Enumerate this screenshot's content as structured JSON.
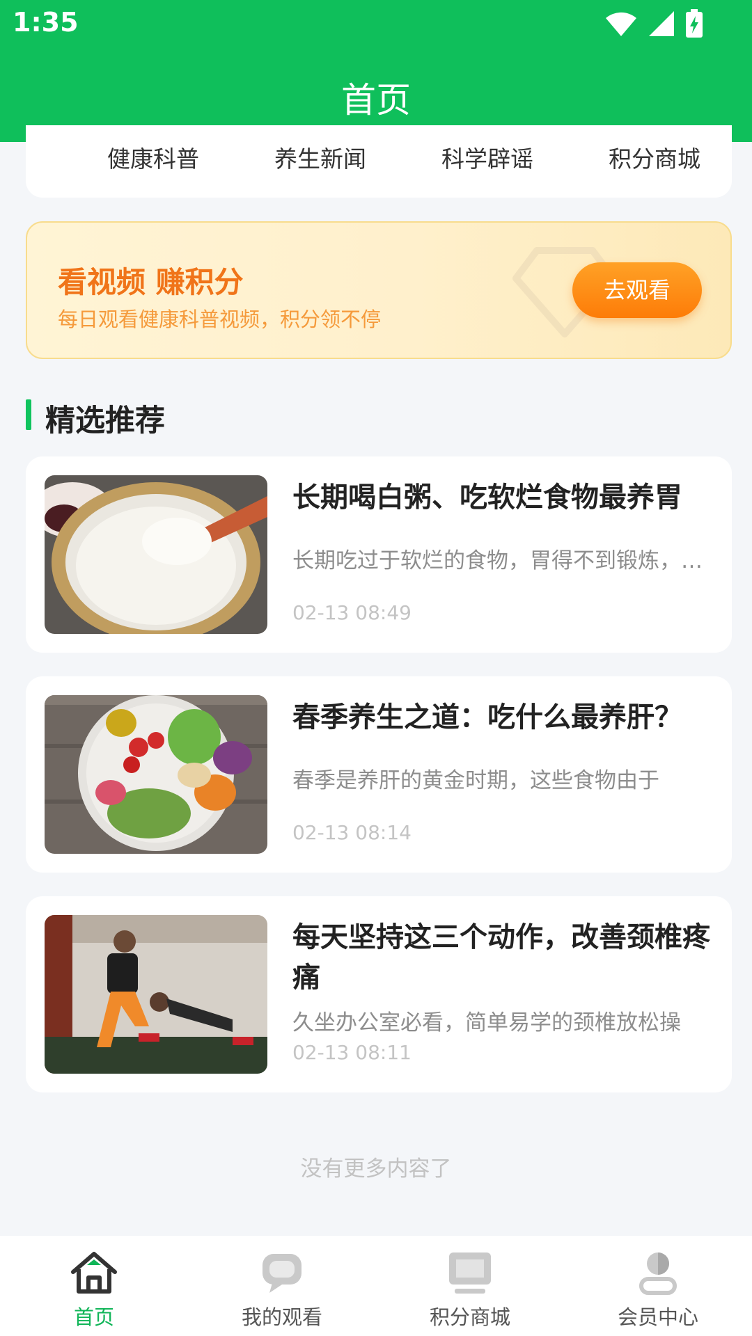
{
  "status_bar": {
    "time": "1:35"
  },
  "app_bar": {
    "title": "首页"
  },
  "categories": [
    "健康科普",
    "养生新闻",
    "科学辟谣",
    "积分商城"
  ],
  "promo": {
    "title": "看视频 赚积分",
    "subtitle": "每日观看健康科普视频，积分领不停",
    "button": "去观看"
  },
  "section": {
    "title": "精选推荐"
  },
  "articles": [
    {
      "title": "长期喝白粥、吃软烂食物最养胃",
      "summary": "长期吃过于软烂的食物，胃得不到锻炼，时间久了消化功能反而会下降",
      "date": "02-13 08:49",
      "image": "porridge-bowl-photo"
    },
    {
      "title": "春季养生之道：吃什么最养肝？",
      "summary": "春季是养肝的黄金时期，这些食物由于",
      "date": "02-13 08:14",
      "image": "vegetable-salad-photo"
    },
    {
      "title": "每天坚持这三个动作，改善颈椎疼痛",
      "summary": "久坐办公室必看，简单易学的颈椎放松操",
      "date": "02-13 08:11",
      "image": "fitness-training-photo"
    }
  ],
  "list_end": "没有更多内容了",
  "bottom_nav": [
    {
      "label": "首页",
      "icon": "home-icon",
      "active": true
    },
    {
      "label": "我的观看",
      "icon": "chat-bubble-icon",
      "active": false
    },
    {
      "label": "积分商城",
      "icon": "monitor-icon",
      "active": false
    },
    {
      "label": "会员中心",
      "icon": "user-icon",
      "active": false
    }
  ],
  "colors": {
    "primary": "#0fbf5b",
    "promo_text": "#f07419",
    "promo_button": "#fd7c08",
    "background": "#f4f6f9"
  }
}
